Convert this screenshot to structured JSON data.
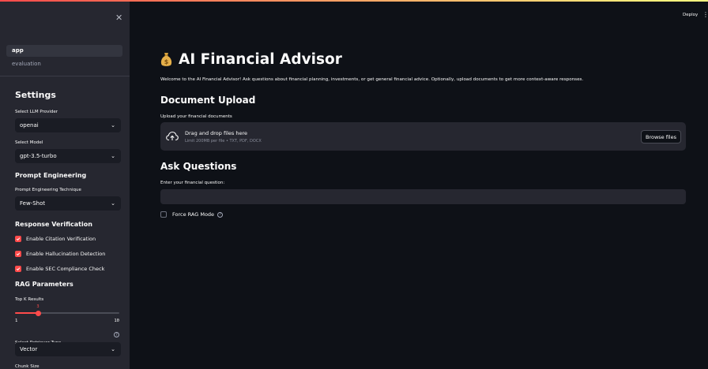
{
  "header": {
    "deploy_label": "Deploy",
    "menu_icon": "more-vertical-icon",
    "close_icon": "close-icon"
  },
  "nav": {
    "items": [
      {
        "label": "app",
        "active": true
      },
      {
        "label": "evaluation",
        "active": false
      }
    ]
  },
  "sidebar": {
    "settings_title": "Settings",
    "llm_provider_label": "Select LLM Provider",
    "llm_provider_value": "openai",
    "model_label": "Select Model",
    "model_value": "gpt-3.5-turbo",
    "prompt_eng_title": "Prompt Engineering",
    "prompt_technique_label": "Prompt Engineering Technique",
    "prompt_technique_value": "Few-Shot",
    "verification_title": "Response Verification",
    "checkboxes": [
      {
        "label": "Enable Citation Verification",
        "checked": true
      },
      {
        "label": "Enable Hallucination Detection",
        "checked": true
      },
      {
        "label": "Enable SEC Compliance Check",
        "checked": true
      }
    ],
    "rag_title": "RAG Parameters",
    "topk_label": "Top K Results",
    "topk_value": "3",
    "topk_min": "1",
    "topk_max": "10",
    "retriever_label": "Select Retriever Type",
    "retriever_value": "Vector",
    "chunk_size_label": "Chunk Size"
  },
  "main": {
    "title": "AI Financial Advisor",
    "title_icon": "money-bag-icon",
    "welcome": "Welcome to the AI Financial Advisor! Ask questions about financial planning, investments, or get general financial advice. Optionally, upload documents to get more context-aware responses.",
    "upload_heading": "Document Upload",
    "upload_label": "Upload your financial documents",
    "dropzone_title": "Drag and drop files here",
    "dropzone_subtitle": "Limit 200MB per file • TXT, PDF, DOCX",
    "browse_label": "Browse files",
    "ask_heading": "Ask Questions",
    "question_label": "Enter your financial question:",
    "question_value": "",
    "force_rag_label": "Force RAG Mode",
    "force_rag_checked": false
  },
  "colors": {
    "accent": "#ff4b4b",
    "background": "#0e1117",
    "sidebar": "#262730"
  }
}
